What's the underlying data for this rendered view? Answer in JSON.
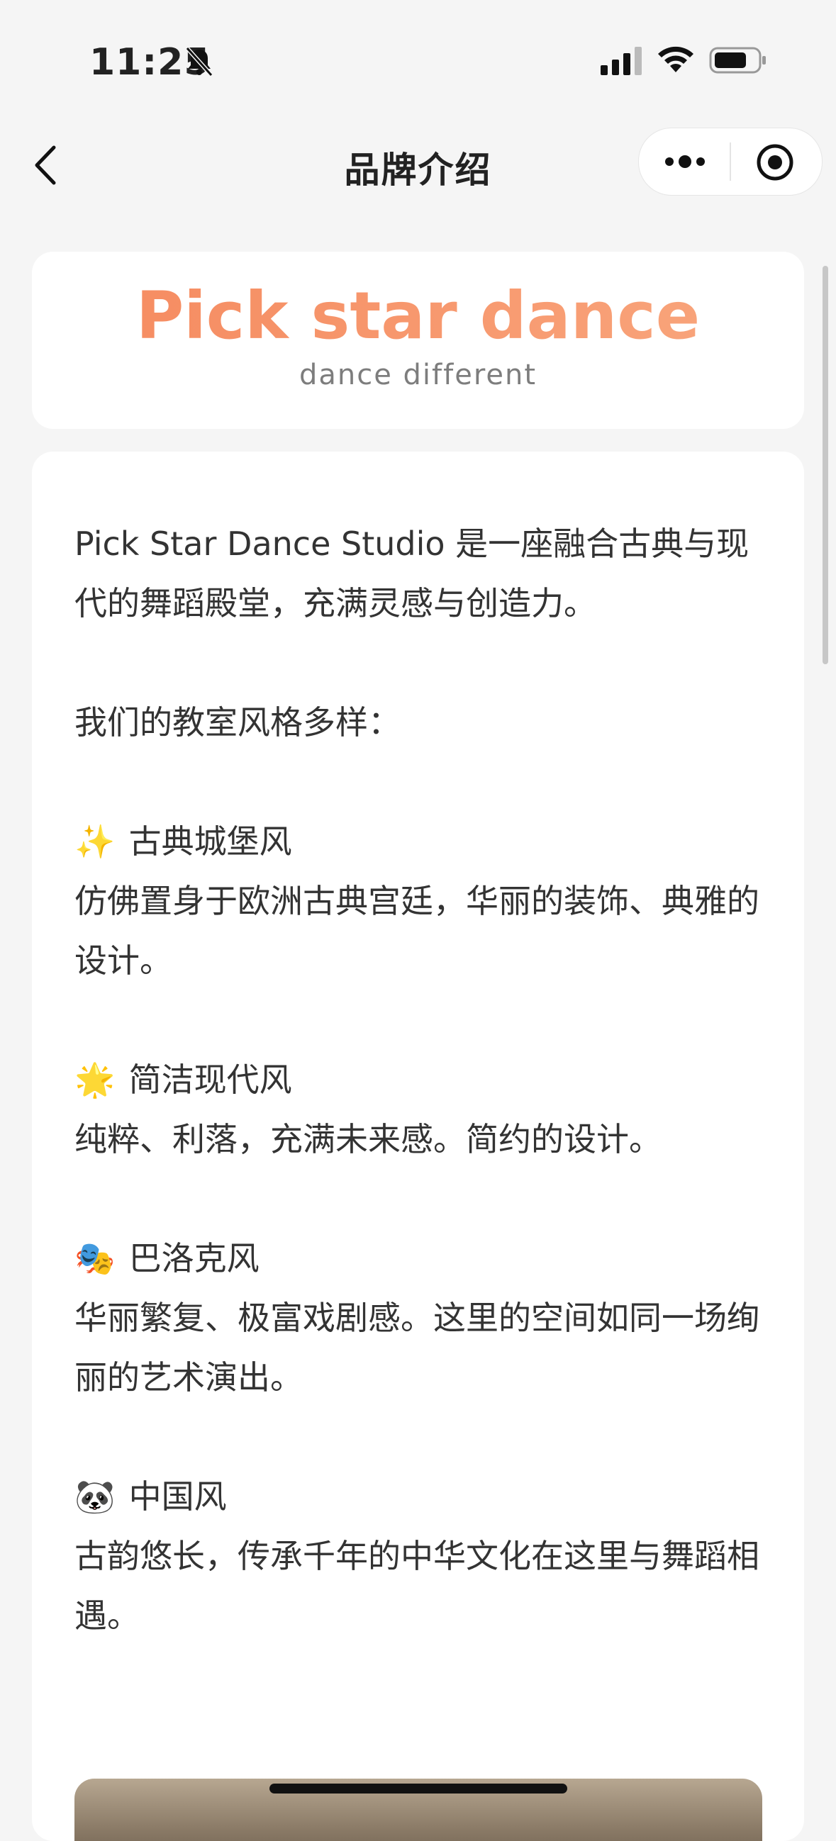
{
  "status_bar": {
    "time": "11:25"
  },
  "nav": {
    "title": "品牌介绍"
  },
  "brand": {
    "title": "Pick star dance",
    "subtitle": "dance different"
  },
  "content": {
    "intro": "Pick Star Dance Studio 是一座融合古典与现代的舞蹈殿堂，充满灵感与创造力。",
    "styles_intro": "我们的教室风格多样：",
    "styles": [
      {
        "emoji": "✨",
        "name": "古典城堡风",
        "desc": "仿佛置身于欧洲古典宫廷，华丽的装饰、典雅的设计。"
      },
      {
        "emoji": "🌟",
        "name": "简洁现代风",
        "desc": "纯粹、利落，充满未来感。简约的设计。"
      },
      {
        "emoji": "🎭",
        "name": "巴洛克风",
        "desc": "华丽繁复、极富戏剧感。这里的空间如同一场绚丽的艺术演出。"
      },
      {
        "emoji": "🐼",
        "name": "中国风",
        "desc": "古韵悠长，传承千年的中华文化在这里与舞蹈相遇。"
      }
    ]
  },
  "colors": {
    "brand_gradient_start": "#f5895e",
    "brand_gradient_end": "#f9a77e",
    "background": "#f5f5f5"
  }
}
